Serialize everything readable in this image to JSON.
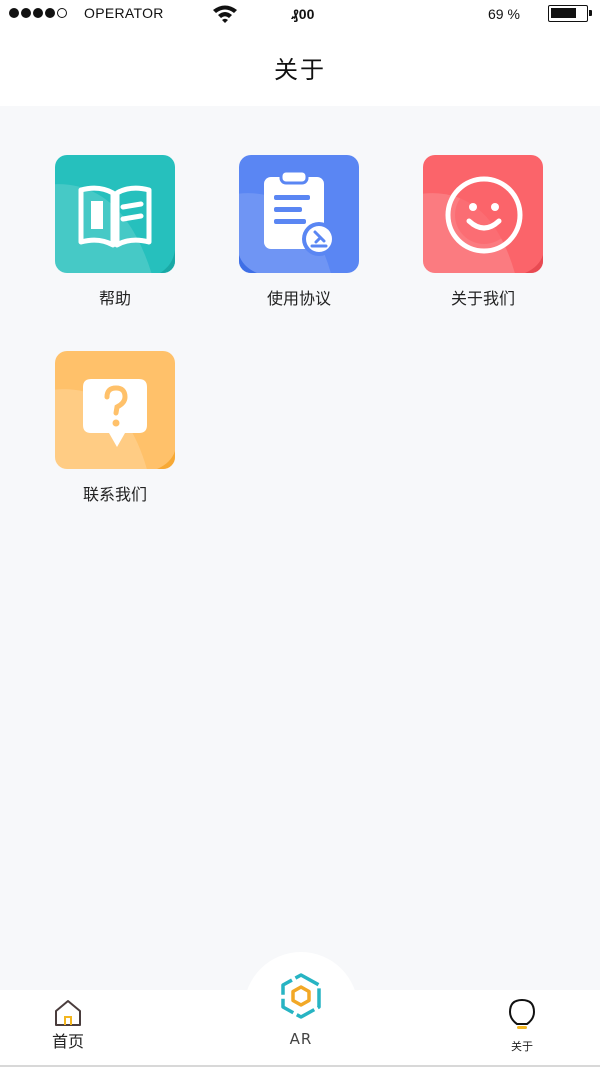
{
  "status_bar": {
    "carrier": "OPERATOR",
    "time": "₰00",
    "battery_percent": "69 %",
    "battery_level": 0.69
  },
  "header": {
    "title": "关于"
  },
  "grid": {
    "items": [
      {
        "label": "帮助",
        "color": "#26c0bd",
        "icon": "book-icon"
      },
      {
        "label": "使用协议",
        "color": "#5a86f3",
        "icon": "clipboard-icon"
      },
      {
        "label": "关于我们",
        "color": "#fb646a",
        "icon": "smiley-icon"
      },
      {
        "label": "联系我们",
        "color": "#ffc16a",
        "icon": "question-bubble-icon"
      }
    ]
  },
  "tabbar": {
    "home_label": "首页",
    "ar_label": "AR",
    "about_label": "关于"
  }
}
